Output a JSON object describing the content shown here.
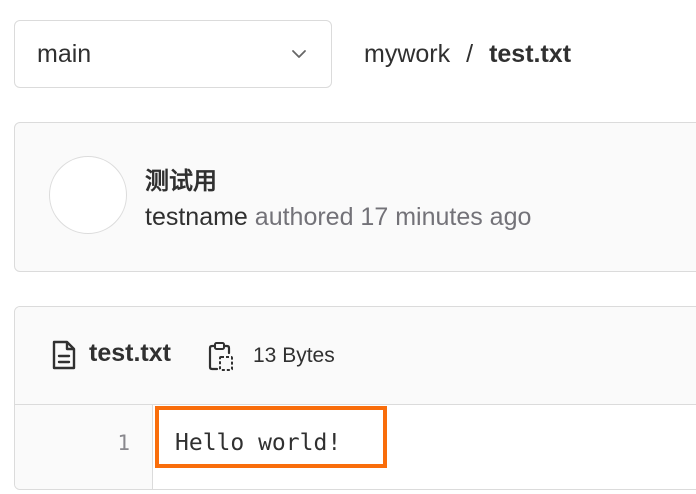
{
  "branch_selector": {
    "value": "main",
    "icon": "chevron-down-icon"
  },
  "breadcrumb": {
    "project": "mywork",
    "separator": "/",
    "file": "test.txt"
  },
  "commit": {
    "title": "测试用",
    "author": "testname",
    "authored_text": "authored 17 minutes ago"
  },
  "file": {
    "icon": "file-text-icon",
    "name": "test.txt",
    "copy_icon": "copy-clipboard-icon",
    "size": "13 Bytes",
    "lines": [
      {
        "number": "1",
        "text": "Hello world!"
      }
    ]
  },
  "colors": {
    "highlight_border": "#f96d0b",
    "muted_text": "#737278",
    "border": "#dbdbdb"
  }
}
